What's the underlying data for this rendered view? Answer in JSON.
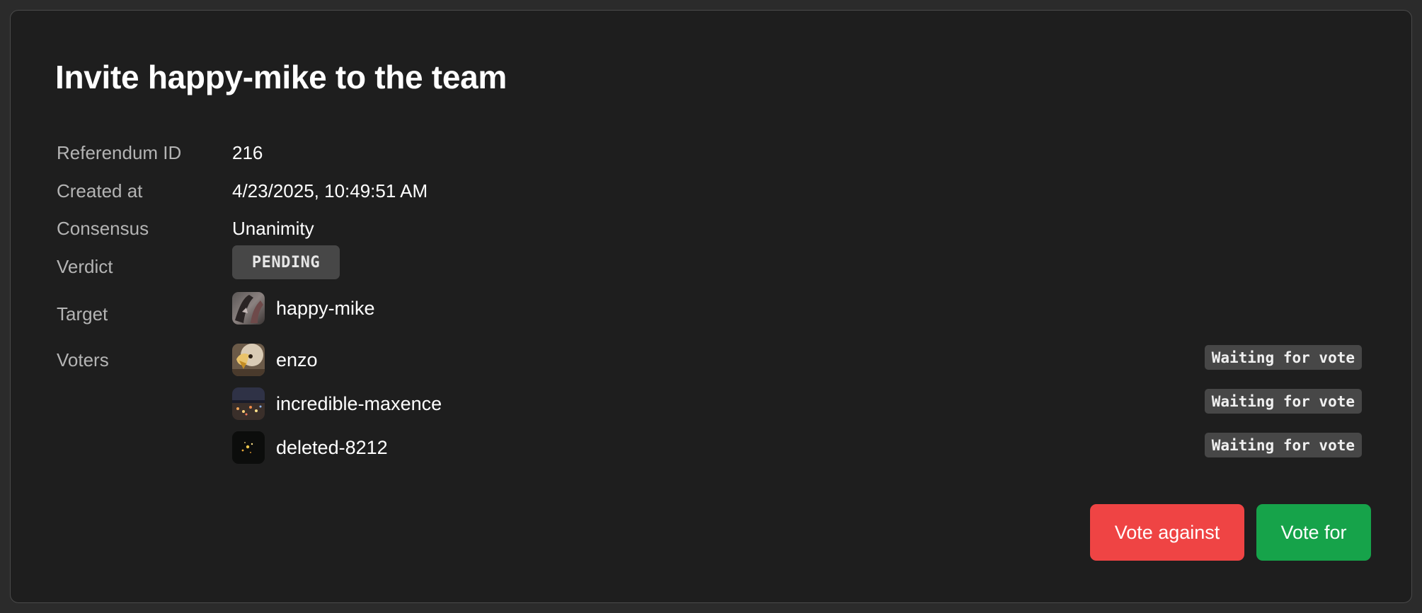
{
  "title": "Invite happy-mike to the team",
  "fields": {
    "referendum_id_label": "Referendum ID",
    "referendum_id": "216",
    "created_at_label": "Created at",
    "created_at": "4/23/2025, 10:49:51 AM",
    "consensus_label": "Consensus",
    "consensus": "Unanimity",
    "verdict_label": "Verdict",
    "verdict": "PENDING",
    "target_label": "Target",
    "voters_label": "Voters"
  },
  "target": {
    "name": "happy-mike",
    "avatar": "abstract-photo-avatar"
  },
  "voters": [
    {
      "name": "enzo",
      "status": "Waiting for vote",
      "avatar": "eagle-photo-avatar"
    },
    {
      "name": "incredible-maxence",
      "status": "Waiting for vote",
      "avatar": "city-night-photo-avatar"
    },
    {
      "name": "deleted-8212",
      "status": "Waiting for vote",
      "avatar": "dark-sparkle-avatar"
    }
  ],
  "actions": {
    "vote_against": "Vote against",
    "vote_for": "Vote for"
  },
  "colors": {
    "page_background": "#2b2b2b",
    "card_background": "#1e1e1e",
    "badge_background": "#474747",
    "vote_against": "#ef4444",
    "vote_for": "#16a34a"
  }
}
